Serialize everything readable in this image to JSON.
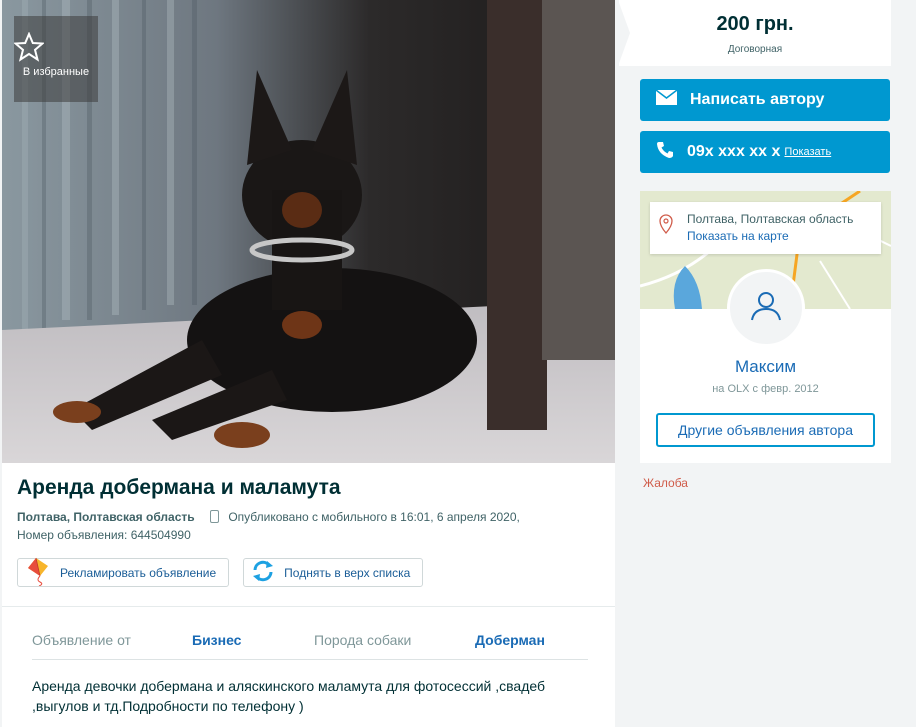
{
  "favorites": {
    "label": "В избранные",
    "icon": "star-icon"
  },
  "ad": {
    "title": "Аренда добермана и маламута",
    "location": "Полтава, Полтавская область",
    "published": "Опубликовано с мобильного   в 16:01, 6 апреля 2020,",
    "ad_number": "Номер объявления: 644504990"
  },
  "promo": {
    "advertise_label": "Рекламировать объявление",
    "lift_label": "Поднять в верх списка"
  },
  "params": {
    "from_label": "Объявление от",
    "from_value": "Бизнес",
    "breed_label": "Порода собаки",
    "breed_value": "Доберман"
  },
  "description": "Аренда девочки добермана и аляскинского маламута для фотосессий ,свадеб ,выгулов и тд.Подробности по телефону )",
  "price": {
    "value": "200 грн.",
    "note": "Договорная"
  },
  "contact": {
    "write_label": "Написать автору",
    "phone_masked": "09x xxx xx x",
    "show_label": "Показать"
  },
  "author": {
    "location": "Полтава, Полтавская область",
    "map_link": "Показать на карте",
    "name": "Максим",
    "since": "на OLX с февр. 2012",
    "other_ads_label": "Другие объявления автора"
  },
  "complaint_label": "Жалоба",
  "colors": {
    "accent": "#0098d0",
    "link": "#1a6bb5",
    "text": "#002f34",
    "complaint": "#d05c4a"
  }
}
